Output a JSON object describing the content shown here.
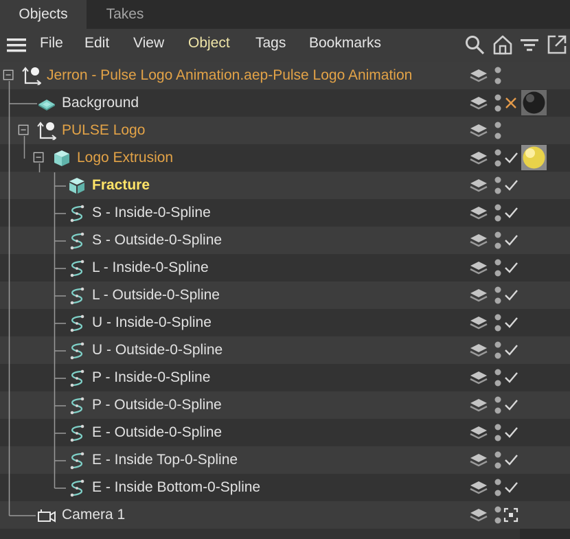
{
  "tabs": [
    {
      "label": "Objects",
      "active": true
    },
    {
      "label": "Takes",
      "active": false
    }
  ],
  "menu": {
    "items": [
      "File",
      "Edit",
      "View",
      "Object",
      "Tags",
      "Bookmarks"
    ],
    "active": "Object"
  },
  "toolbar": {
    "icons": [
      "hamburger-icon",
      "search-icon",
      "home-icon",
      "filter-icon",
      "new-window-icon"
    ]
  },
  "colors": {
    "orange": "#e3a347",
    "yellow": "#ffe468",
    "white": "#e2e2e2",
    "menu_active": "#f0e6a8"
  },
  "rows": [
    {
      "label": "Jerron - Pulse Logo Animation.aep-Pulse Logo Animation",
      "icon": "null-icon",
      "color": "orange",
      "expanded": true,
      "flag": "none",
      "tag": "none"
    },
    {
      "label": "Background",
      "icon": "background-icon",
      "color": "white",
      "flag": "cross",
      "tag": "material-dark"
    },
    {
      "label": "PULSE Logo",
      "icon": "null-icon",
      "color": "orange",
      "expanded": true,
      "flag": "none",
      "tag": "none"
    },
    {
      "label": "Logo Extrusion",
      "icon": "extrude-icon",
      "color": "orange",
      "expanded": true,
      "flag": "check",
      "tag": "material-yellow"
    },
    {
      "label": "Fracture",
      "icon": "fracture-icon",
      "color": "yellow",
      "flag": "check",
      "tag": "none"
    },
    {
      "label": "S - Inside-0-Spline",
      "icon": "spline-icon",
      "color": "white",
      "flag": "check",
      "tag": "none"
    },
    {
      "label": "S - Outside-0-Spline",
      "icon": "spline-icon",
      "color": "white",
      "flag": "check",
      "tag": "none"
    },
    {
      "label": "L - Inside-0-Spline",
      "icon": "spline-icon",
      "color": "white",
      "flag": "check",
      "tag": "none"
    },
    {
      "label": "L - Outside-0-Spline",
      "icon": "spline-icon",
      "color": "white",
      "flag": "check",
      "tag": "none"
    },
    {
      "label": "U - Inside-0-Spline",
      "icon": "spline-icon",
      "color": "white",
      "flag": "check",
      "tag": "none"
    },
    {
      "label": "U - Outside-0-Spline",
      "icon": "spline-icon",
      "color": "white",
      "flag": "check",
      "tag": "none"
    },
    {
      "label": "P - Inside-0-Spline",
      "icon": "spline-icon",
      "color": "white",
      "flag": "check",
      "tag": "none"
    },
    {
      "label": "P - Outside-0-Spline",
      "icon": "spline-icon",
      "color": "white",
      "flag": "check",
      "tag": "none"
    },
    {
      "label": "E - Outside-0-Spline",
      "icon": "spline-icon",
      "color": "white",
      "flag": "check",
      "tag": "none"
    },
    {
      "label": "E - Inside Top-0-Spline",
      "icon": "spline-icon",
      "color": "white",
      "flag": "check",
      "tag": "none"
    },
    {
      "label": "E - Inside Bottom-0-Spline",
      "icon": "spline-icon",
      "color": "white",
      "flag": "check",
      "tag": "none"
    },
    {
      "label": "Camera 1",
      "icon": "camera-icon",
      "color": "white",
      "flag": "target",
      "tag": "none"
    }
  ]
}
